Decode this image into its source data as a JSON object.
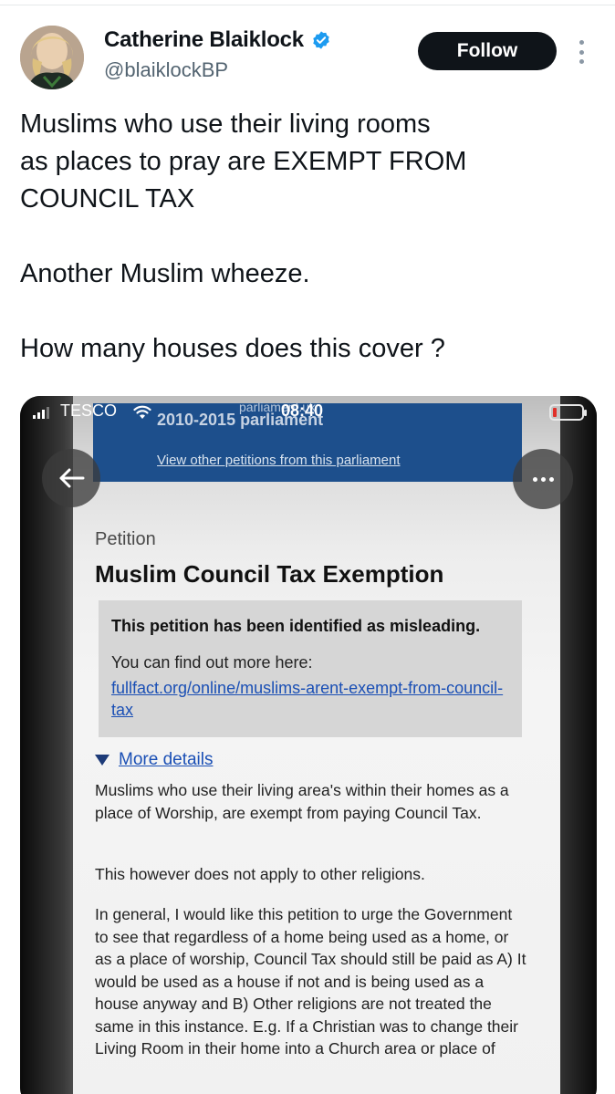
{
  "tweet": {
    "author": {
      "display_name": "Catherine Blaiklock",
      "handle": "@blaiklockBP",
      "verified_icon": "verified-badge-icon",
      "avatar_icon": "profile-photo"
    },
    "follow_label": "Follow",
    "more_icon": "more-vertical-icon",
    "text": "Muslims who use their living rooms\nas places to pray are EXEMPT FROM\nCOUNCIL TAX\n\nAnother Muslim wheeze.\n\nHow many houses does this cover ?"
  },
  "media": {
    "status_bar": {
      "carrier": "TESCO",
      "time": "08:40"
    },
    "banner": {
      "url_fragment": "parliament.uk",
      "parliament": "2010-2015 parliament",
      "link": "View other petitions from this parliament"
    },
    "petition": {
      "label": "Petition",
      "title": "Muslim Council Tax Exemption",
      "notice_heading": "This petition has been identified as misleading.",
      "notice_body": "You can find out more here:",
      "notice_link": "fullfact.org/online/muslims-arent-exempt-from-council-tax",
      "details_label": "More details",
      "para1": "Muslims who use their living area's within their homes as a place of Worship, are exempt from paying Council Tax.",
      "para2": "This however does not apply to other religions.",
      "para3": "In general, I would like this petition to urge the Government to see that regardless of a home being used as a home, or as a place of worship, Council Tax should still be paid as A) It would be used as a house if not and is being used as a house anyway and B) Other religions are not treated the same in this instance. E.g. If a Christian was to change their Living Room in their home into a Church area or place of"
    }
  }
}
